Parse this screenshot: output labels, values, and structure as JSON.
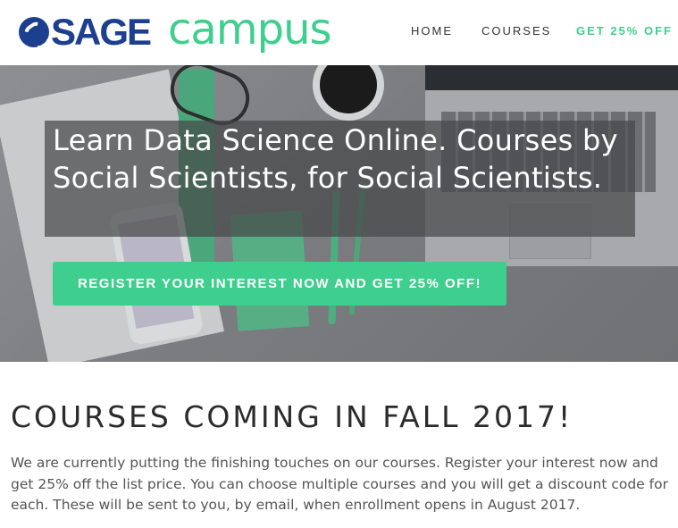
{
  "header": {
    "logo_brand": "SAGE",
    "logo_product": "campus",
    "nav": {
      "home": "HOME",
      "courses": "COURSES",
      "offer": "GET 25% OFF"
    }
  },
  "hero": {
    "title": "Learn Data Science Online. Courses by Social Scientists, for Social Scientists.",
    "cta_label": "REGISTER YOUR INTEREST NOW AND GET 25% OFF!"
  },
  "main": {
    "heading": "COURSES COMING IN FALL 2017!",
    "body": "We are currently putting the finishing touches on our courses. Register your interest now and get 25% off the list price. You can choose multiple courses and you will get a discount code for each. These will be sent to you, by email, when enrollment opens in August 2017."
  },
  "colors": {
    "brand_blue": "#1d3f8f",
    "accent_green": "#3ecf8e"
  }
}
